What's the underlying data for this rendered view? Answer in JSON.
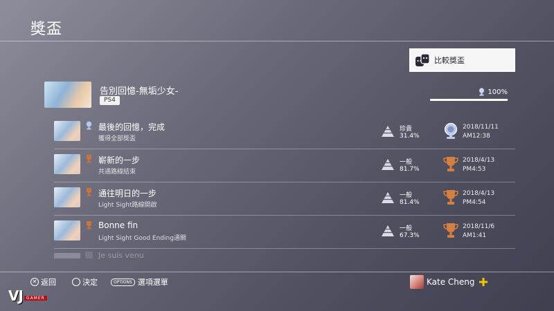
{
  "header": {
    "title": "獎盃"
  },
  "compare_button": {
    "label": "比較獎盃",
    "icon": "faces-icon"
  },
  "game": {
    "title": "告別回憶-無垢少女-",
    "platform": "PS4",
    "progress_text": "100%",
    "progress": 1.0
  },
  "trophies": [
    {
      "name": "最後的回憶，完成",
      "description": "獲得全部獎盃",
      "type": "platinum",
      "rarity_label": "珍貴",
      "rarity_pct": "31.4%",
      "rarity_level": 2,
      "date": "2018/11/11",
      "time": "AM12:38"
    },
    {
      "name": "嶄新的一步",
      "description": "共通路線結束",
      "type": "bronze",
      "rarity_label": "一般",
      "rarity_pct": "81.7%",
      "rarity_level": 1,
      "date": "2018/4/13",
      "time": "PM4:53"
    },
    {
      "name": "通往明日的一步",
      "description": "Light Sight路線開啟",
      "type": "bronze",
      "rarity_label": "一般",
      "rarity_pct": "81.4%",
      "rarity_level": 1,
      "date": "2018/4/13",
      "time": "PM4:54"
    },
    {
      "name": "Bonne fin",
      "description": "Light Sight Good Ending通關",
      "type": "bronze",
      "rarity_label": "一般",
      "rarity_pct": "67.3%",
      "rarity_level": 1,
      "date": "2018/11/6",
      "time": "AM1:41"
    }
  ],
  "faded_row": {
    "name": "Je suis venu"
  },
  "footer": {
    "back_label": "返回",
    "confirm_label": "決定",
    "options_key": "OPTIONS",
    "options_label": "選項選單",
    "user_name": "Kate Cheng"
  },
  "watermark": {
    "brand": "VJ",
    "sub": "GAMER"
  },
  "colors": {
    "bronze": "#c8743a",
    "platinum": "#9fb4d8",
    "plus": "#f5c400",
    "brand_red": "#b0121b"
  }
}
